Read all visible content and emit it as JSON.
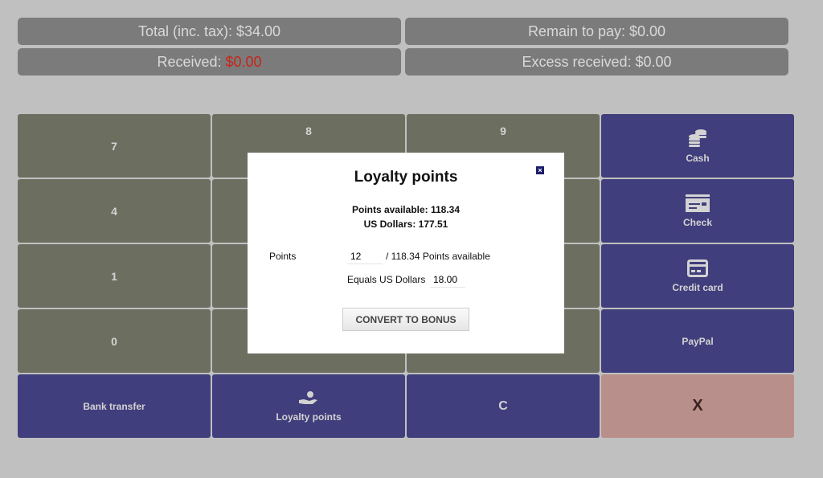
{
  "summary": {
    "total": "Total (inc. tax): $34.00",
    "remain": "Remain to pay: $0.00",
    "received_label": "Received: ",
    "received_value": "$0.00",
    "excess": "Excess received: $0.00"
  },
  "keypad": {
    "k7": "7",
    "k8": "8",
    "k9": "9",
    "k4": "4",
    "k1": "1",
    "k0": "0",
    "clear": "C",
    "cancel": "X"
  },
  "payments": {
    "cash": "Cash",
    "check": "Check",
    "credit_card": "Credit card",
    "paypal": "PayPal",
    "bank_transfer": "Bank transfer",
    "loyalty": "Loyalty points"
  },
  "modal": {
    "title": "Loyalty points",
    "points_available": "Points available: 118.34",
    "us_dollars": "US Dollars: 177.51",
    "points_label": "Points",
    "points_value": "12",
    "points_suffix": "/ 118.34 Points available",
    "equals_label": "Equals US Dollars",
    "equals_value": "18.00",
    "convert": "CONVERT TO BONUS",
    "close": "×"
  },
  "colors": {
    "keypad": "#6c6e60",
    "payment": "#403e7c",
    "cancel": "#b98f8b",
    "received": "#c8241a"
  }
}
